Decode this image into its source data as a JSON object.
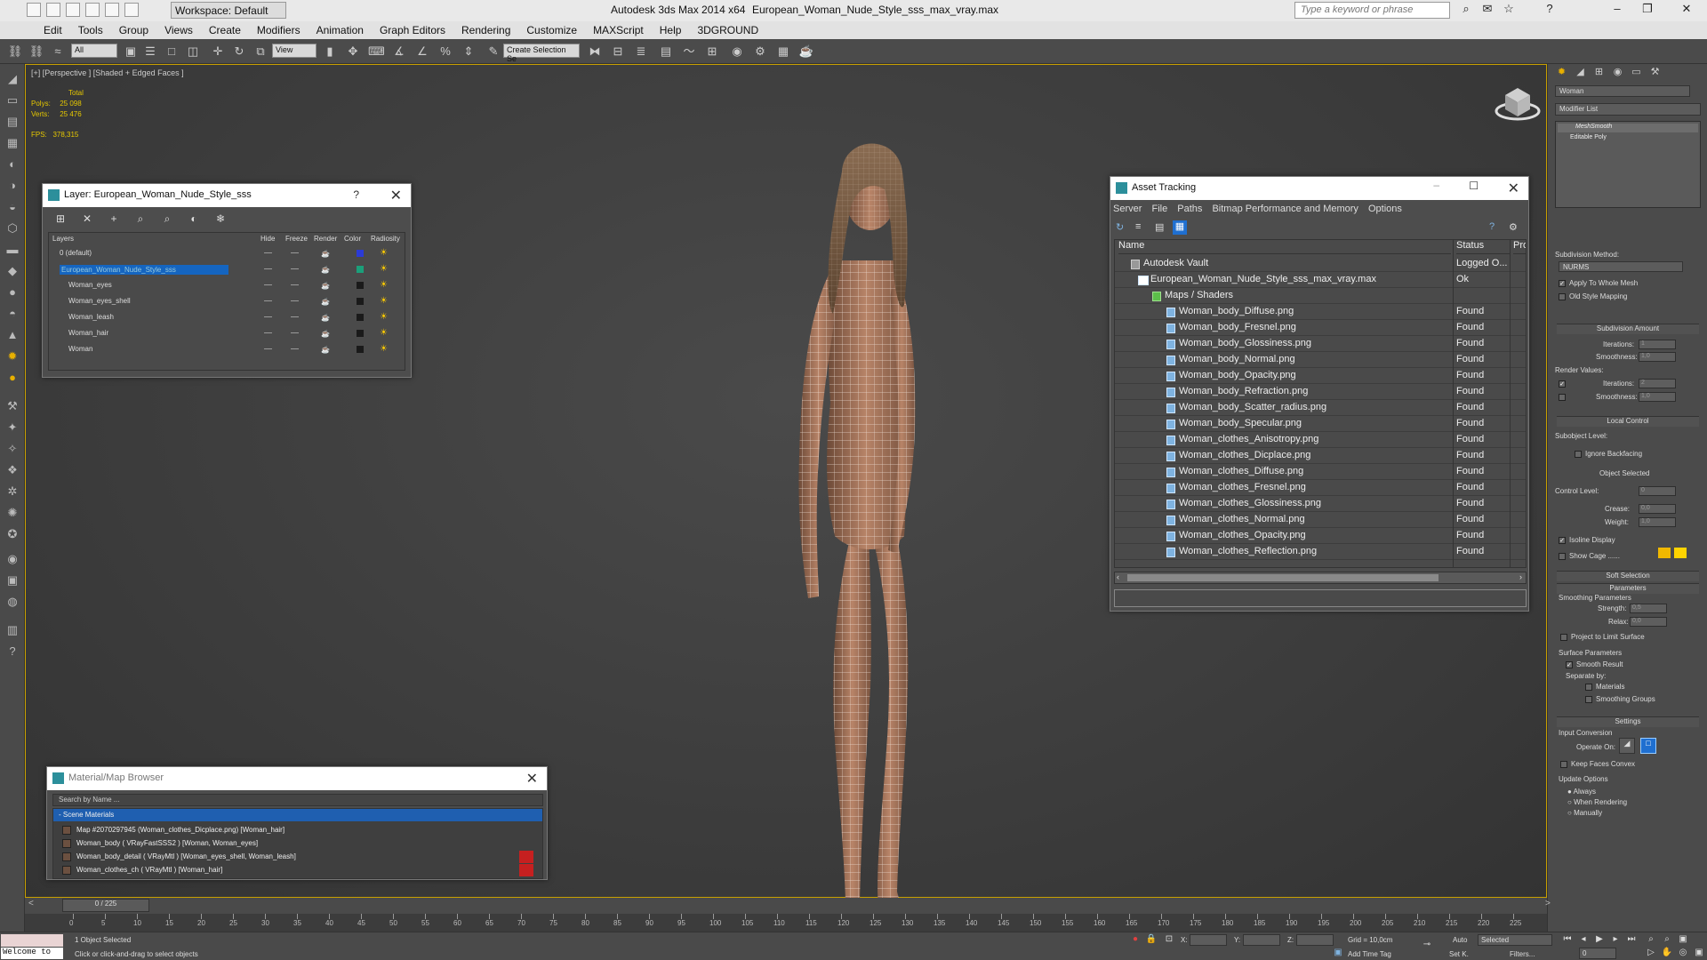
{
  "title_bar": {
    "workspace": "Workspace: Default",
    "app_title": "Autodesk 3ds Max  2014 x64",
    "file_title": "European_Woman_Nude_Style_sss_max_vray.max",
    "search_placeholder": "Type a keyword or phrase"
  },
  "menu": [
    "Edit",
    "Tools",
    "Group",
    "Views",
    "Create",
    "Modifiers",
    "Animation",
    "Graph Editors",
    "Rendering",
    "Customize",
    "MAXScript",
    "Help",
    "3DGROUND"
  ],
  "toolbar": {
    "filter": "All",
    "ref_coord": "View",
    "named_selection": "Create Selection Se"
  },
  "viewport": {
    "label": "[+] [Perspective ] [Shaded + Edged Faces ]",
    "stats_header": "Total",
    "polys_label": "Polys:",
    "polys": "25 098",
    "verts_label": "Verts:",
    "verts": "25 476",
    "fps_label": "FPS:",
    "fps": "378,315"
  },
  "layer_dialog": {
    "title": "Layer: European_Woman_Nude_Style_sss",
    "help": "?",
    "columns": [
      "Layers",
      "Hide",
      "Freeze",
      "Render",
      "Color",
      "Radiosity"
    ],
    "rows": [
      {
        "name": "0 (default)",
        "color": "#2b3bd6",
        "selected": false,
        "indent": 0
      },
      {
        "name": "European_Woman_Nude_Style_sss",
        "color": "#1b9f7a",
        "selected": true,
        "indent": 0
      },
      {
        "name": "Woman_eyes",
        "color": "#1a1a1a",
        "selected": false,
        "indent": 1
      },
      {
        "name": "Woman_eyes_shell",
        "color": "#1a1a1a",
        "selected": false,
        "indent": 1
      },
      {
        "name": "Woman_leash",
        "color": "#1a1a1a",
        "selected": false,
        "indent": 1
      },
      {
        "name": "Woman_hair",
        "color": "#1a1a1a",
        "selected": false,
        "indent": 1
      },
      {
        "name": "Woman",
        "color": "#1a1a1a",
        "selected": false,
        "indent": 1
      }
    ]
  },
  "asset_dialog": {
    "title": "Asset Tracking",
    "menu": [
      "Server",
      "File",
      "Paths",
      "Bitmap Performance and Memory",
      "Options"
    ],
    "columns": [
      "Name",
      "Status",
      "Pro"
    ],
    "rows": [
      {
        "name": "Autodesk Vault",
        "status": "Logged O...",
        "level": 0,
        "kind": "vault"
      },
      {
        "name": "European_Woman_Nude_Style_sss_max_vray.max",
        "status": "Ok",
        "level": 1,
        "kind": "file"
      },
      {
        "name": "Maps / Shaders",
        "status": "",
        "level": 2,
        "kind": "folder"
      },
      {
        "name": "Woman_body_Diffuse.png",
        "status": "Found",
        "level": 3,
        "kind": "map"
      },
      {
        "name": "Woman_body_Fresnel.png",
        "status": "Found",
        "level": 3,
        "kind": "map"
      },
      {
        "name": "Woman_body_Glossiness.png",
        "status": "Found",
        "level": 3,
        "kind": "map"
      },
      {
        "name": "Woman_body_Normal.png",
        "status": "Found",
        "level": 3,
        "kind": "map"
      },
      {
        "name": "Woman_body_Opacity.png",
        "status": "Found",
        "level": 3,
        "kind": "map"
      },
      {
        "name": "Woman_body_Refraction.png",
        "status": "Found",
        "level": 3,
        "kind": "map"
      },
      {
        "name": "Woman_body_Scatter_radius.png",
        "status": "Found",
        "level": 3,
        "kind": "map"
      },
      {
        "name": "Woman_body_Specular.png",
        "status": "Found",
        "level": 3,
        "kind": "map"
      },
      {
        "name": "Woman_clothes_Anisotropy.png",
        "status": "Found",
        "level": 3,
        "kind": "map"
      },
      {
        "name": "Woman_clothes_Dicplace.png",
        "status": "Found",
        "level": 3,
        "kind": "map"
      },
      {
        "name": "Woman_clothes_Diffuse.png",
        "status": "Found",
        "level": 3,
        "kind": "map"
      },
      {
        "name": "Woman_clothes_Fresnel.png",
        "status": "Found",
        "level": 3,
        "kind": "map"
      },
      {
        "name": "Woman_clothes_Glossiness.png",
        "status": "Found",
        "level": 3,
        "kind": "map"
      },
      {
        "name": "Woman_clothes_Normal.png",
        "status": "Found",
        "level": 3,
        "kind": "map"
      },
      {
        "name": "Woman_clothes_Opacity.png",
        "status": "Found",
        "level": 3,
        "kind": "map"
      },
      {
        "name": "Woman_clothes_Reflection.png",
        "status": "Found",
        "level": 3,
        "kind": "map"
      }
    ]
  },
  "material_browser": {
    "title": "Material/Map Browser",
    "search_placeholder": "Search by Name ...",
    "group": "- Scene Materials",
    "rows": [
      "Map #2070297945 (Woman_clothes_Dicplace.png) [Woman_hair]",
      "Woman_body  ( VRayFastSSS2 ) [Woman, Woman_eyes]",
      "Woman_body_detail  ( VRayMtl ) [Woman_eyes_shell, Woman_leash]",
      "Woman_clothes_ch  ( VRayMtl ) [Woman_hair]"
    ]
  },
  "command_panel": {
    "object_name": "Woman",
    "modifier_list": "Modifier List",
    "stack": [
      "MeshSmooth",
      "Editable Poly"
    ],
    "subdivision_method_label": "Subdivision Method:",
    "subdivision_method": "NURMS",
    "apply_whole_mesh": "Apply To Whole Mesh",
    "old_style_mapping": "Old Style Mapping",
    "subdivision_amount": "Subdivision Amount",
    "iterations_label": "Iterations:",
    "iterations": "1",
    "smoothness_label": "Smoothness:",
    "smoothness": "1,0",
    "render_values": "Render Values:",
    "render_iterations": "2",
    "render_smoothness": "1,0",
    "local_control": "Local Control",
    "subobject_level": "Subobject Level:",
    "ignore_backfacing": "Ignore Backfacing",
    "object_selected": "Object Selected",
    "control_level_label": "Control Level:",
    "control_level": "0",
    "crease_label": "Crease:",
    "crease": "0,0",
    "weight_label": "Weight:",
    "weight": "1,0",
    "isoline_display": "Isoline Display",
    "show_cage": "Show Cage ......",
    "cage_colors": [
      "#f0b800",
      "#ffd400"
    ],
    "soft_selection": "Soft Selection",
    "parameters": "Parameters",
    "smoothing_params": "Smoothing Parameters",
    "strength_label": "Strength:",
    "strength": "0,5",
    "relax_label": "Relax:",
    "relax": "0,0",
    "project_limit": "Project to Limit Surface",
    "surface_params": "Surface Parameters",
    "smooth_result": "Smooth Result",
    "separate_by": "Separate by:",
    "materials": "Materials",
    "smoothing_groups": "Smoothing Groups",
    "settings": "Settings",
    "input_conversion": "Input Conversion",
    "operate_on": "Operate On:",
    "keep_faces_convex": "Keep Faces Convex",
    "update_options": "Update Options",
    "always": "Always",
    "when_rendering": "When Rendering",
    "manually": "Manually"
  },
  "timeline": {
    "frame": "0 / 225",
    "ticks": [
      "0",
      "5",
      "10",
      "15",
      "20",
      "25",
      "30",
      "35",
      "40",
      "45",
      "50",
      "55",
      "60",
      "65",
      "70",
      "75",
      "80",
      "85",
      "90",
      "95",
      "100",
      "105",
      "110",
      "115",
      "120",
      "125",
      "130",
      "135",
      "140",
      "145",
      "150",
      "155",
      "160",
      "165",
      "170",
      "175",
      "180",
      "185",
      "190",
      "195",
      "200",
      "205",
      "210",
      "215",
      "220",
      "225"
    ]
  },
  "status": {
    "welcome": "Welcome to",
    "selected": "1 Object Selected",
    "prompt": "Click or click-and-drag to select objects",
    "x_label": "X:",
    "y_label": "Y:",
    "z_label": "Z:",
    "grid": "Grid = 10,0cm",
    "add_time_tag": "Add Time Tag",
    "auto": "Auto",
    "set_k": "Set K.",
    "selected_mode": "Selected",
    "filters": "Filters...",
    "frame_field": "0"
  }
}
